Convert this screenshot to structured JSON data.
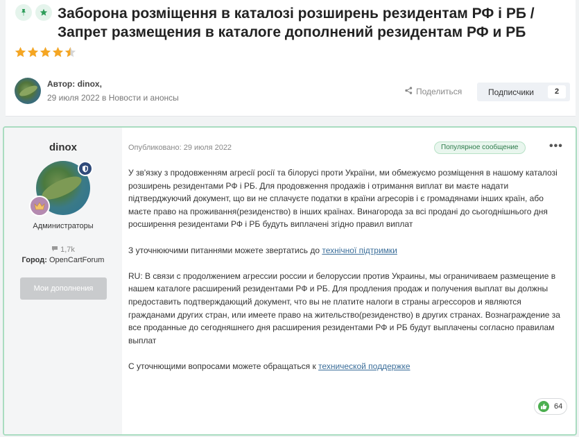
{
  "topic": {
    "title": "Заборона розміщення в каталозі розширень резидентам РФ і РБ / Запрет размещения в каталоге дополнений резидентам РФ и РБ",
    "rating": 4.5,
    "author_label": "Автор: dinox,",
    "date": "29 июля 2022",
    "in_word": "в",
    "forum": "Новости и анонсы",
    "share_label": "Поделиться",
    "subscribers_label": "Подписчики",
    "subscribers_count": "2"
  },
  "post": {
    "author": "dinox",
    "group": "Администраторы",
    "post_count": "1,7k",
    "city_label": "Город:",
    "city": "OpenCartForum",
    "addons_button": "Мои дополнения",
    "published": "Опубликовано: 29 июля 2022",
    "popular_label": "Популярное сообщение",
    "more_label": "•••",
    "body": {
      "p1": "У зв'язку з продовженням агресії росії та білорусі проти України, ми обмежуємо розміщення в нашому каталозі розширень резидентами РФ і РБ. Для продовження продажів і отримання виплат ви маєте надати підтверджуючий документ, що ви не сплачуєте податки в країни агресорів і є громадянами інших країн, або маєте право на проживання(резиденство) в інших країнах. Винагорода за всі продані до сьогоднішнього дня росширення резидентами РФ і РБ будуть виплачені згідно правил виплат",
      "p2_text": "З уточнюючими питаннями можете звертатись до ",
      "p2_link": "технічної підтримки",
      "p3": "RU: В связи с продолжением агрессии россии и белоруссии против Украины, мы ограничиваем размещение в нашем каталоге расширений резидентами РФ и РБ. Для продления продаж и получения выплат вы должны предоставить подтверждающий документ, что вы не платите налоги в страны агрессоров и являются гражданами других стран, или имеете право на жительство(резиденство) в других странах. Вознаграждение за все проданные до сегодняшнего дня расширения резидентами РФ и РБ будут выплачены согласно правилам выплат",
      "p4_text": "С уточнющими вопросами можете обращаться к ",
      "p4_link": "технической поддержке"
    },
    "reaction_count": "64"
  },
  "colors": {
    "accent_green": "#2e9d5a",
    "star": "#f5a623",
    "link": "#3a6d99",
    "post_border": "#a9dcc0"
  },
  "icons": [
    "pin-icon",
    "featured-star-icon",
    "share-icon",
    "shield-icon",
    "rank-crown-icon",
    "comment-icon",
    "ellipsis-icon",
    "like-reaction-icon"
  ]
}
